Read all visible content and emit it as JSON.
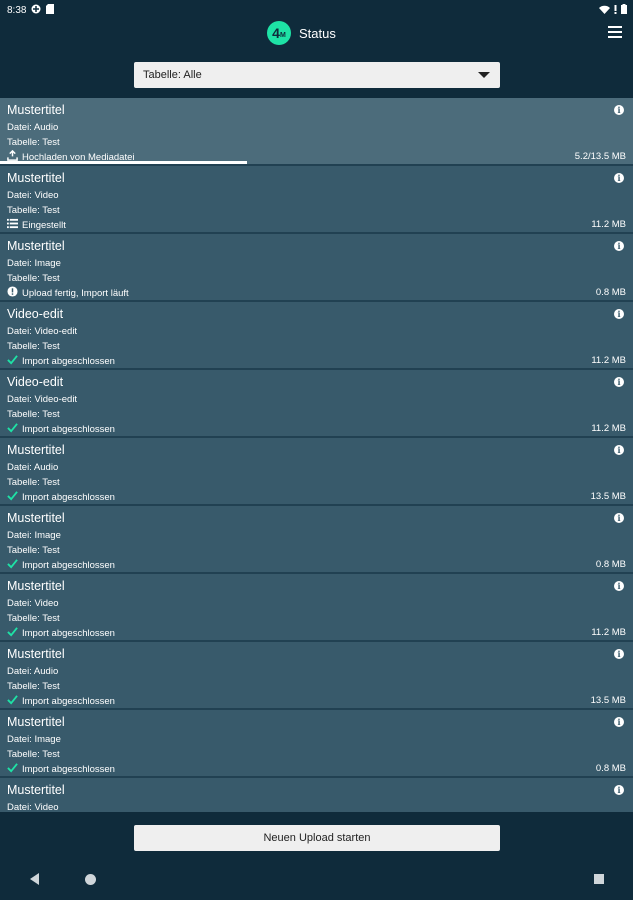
{
  "statusbar": {
    "time": "8:38"
  },
  "app": {
    "logo_text": "4",
    "logo_sub": "M",
    "title": "Status"
  },
  "filter": {
    "selected": "Tabelle: Alle"
  },
  "items": [
    {
      "title": "Mustertitel",
      "line1": "Datei: Audio",
      "line2": "Tabelle: Test",
      "status": "Hochladen von Mediadatei",
      "status_icon": "upload-icon",
      "size": "5.2/13.5 MB",
      "progress": 0.39,
      "active": true
    },
    {
      "title": "Mustertitel",
      "line1": "Datei: Video",
      "line2": "Tabelle: Test",
      "status": "Eingestellt",
      "status_icon": "list-icon",
      "size": "11.2 MB"
    },
    {
      "title": "Mustertitel",
      "line1": "Datei: Image",
      "line2": "Tabelle: Test",
      "status": "Upload fertig, Import läuft",
      "status_icon": "alert-icon",
      "size": "0.8 MB"
    },
    {
      "title": "Video-edit",
      "line1": "Datei: Video-edit",
      "line2": "Tabelle: Test",
      "status": "Import abgeschlossen",
      "status_icon": "check-icon",
      "size": "11.2 MB"
    },
    {
      "title": "Video-edit",
      "line1": "Datei: Video-edit",
      "line2": "Tabelle: Test",
      "status": "Import abgeschlossen",
      "status_icon": "check-icon",
      "size": "11.2 MB"
    },
    {
      "title": "Mustertitel",
      "line1": "Datei: Audio",
      "line2": "Tabelle: Test",
      "status": "Import abgeschlossen",
      "status_icon": "check-icon",
      "size": "13.5 MB"
    },
    {
      "title": "Mustertitel",
      "line1": "Datei: Image",
      "line2": "Tabelle: Test",
      "status": "Import abgeschlossen",
      "status_icon": "check-icon",
      "size": "0.8 MB"
    },
    {
      "title": "Mustertitel",
      "line1": "Datei: Video",
      "line2": "Tabelle: Test",
      "status": "Import abgeschlossen",
      "status_icon": "check-icon",
      "size": "11.2 MB"
    },
    {
      "title": "Mustertitel",
      "line1": "Datei: Audio",
      "line2": "Tabelle: Test",
      "status": "Import abgeschlossen",
      "status_icon": "check-icon",
      "size": "13.5 MB"
    },
    {
      "title": "Mustertitel",
      "line1": "Datei: Image",
      "line2": "Tabelle: Test",
      "status": "Import abgeschlossen",
      "status_icon": "check-icon",
      "size": "0.8 MB"
    },
    {
      "title": "Mustertitel",
      "line1": "Datei: Video",
      "line2": "",
      "status": "",
      "status_icon": "",
      "size": ""
    }
  ],
  "upload_button": {
    "label": "Neuen Upload starten"
  },
  "colors": {
    "accent": "#1ee3a6",
    "background": "#0f2b3b",
    "item": "#385a6b"
  }
}
